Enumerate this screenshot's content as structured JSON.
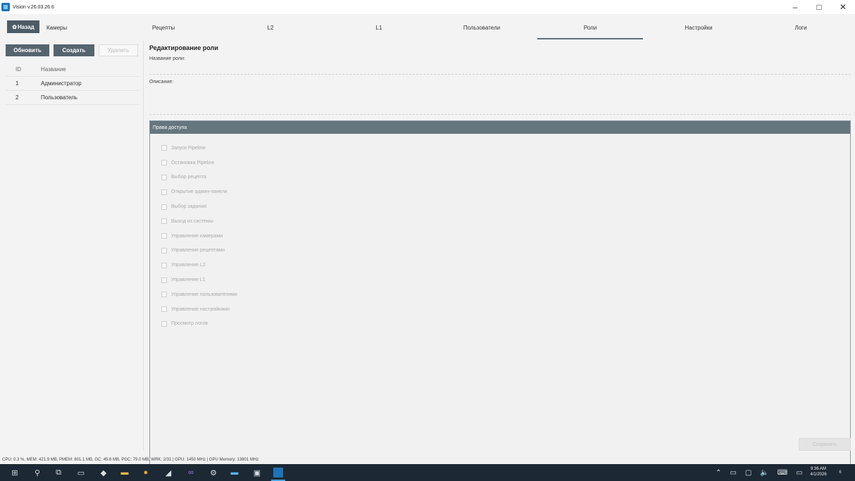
{
  "window": {
    "title": "Vision v.26.03.26.6",
    "controls": {
      "minimize": "–",
      "maximize": "□",
      "close": "✕"
    }
  },
  "nav": {
    "back_label": "Назад",
    "back_icon": "gear-icon",
    "tabs": [
      {
        "label": "Камеры",
        "active": false
      },
      {
        "label": "Рецепты",
        "active": false
      },
      {
        "label": "L2",
        "active": false
      },
      {
        "label": "L1",
        "active": false
      },
      {
        "label": "Пользователи",
        "active": false
      },
      {
        "label": "Роли",
        "active": true
      },
      {
        "label": "Настройки",
        "active": false
      },
      {
        "label": "Логи",
        "active": false
      }
    ]
  },
  "sidebar": {
    "buttons": {
      "refresh": "Обновить",
      "create": "Создать",
      "delete": "Удалить"
    },
    "table": {
      "headers": {
        "id": "ID",
        "name": "Название"
      },
      "rows": [
        {
          "id": "1",
          "name": "Администратор"
        },
        {
          "id": "2",
          "name": "Пользователь"
        }
      ]
    }
  },
  "editor": {
    "title": "Редактирование роли",
    "name_label": "Название роли:",
    "name_value": "",
    "description_label": "Описание:",
    "description_value": "",
    "permissions_header": "Права доступа",
    "permissions": [
      "Запуск Pipeline",
      "Остановка Pipeline",
      "Выбор рецепта",
      "Открытие админ-панели",
      "Выбор задания",
      "Выход из системы",
      "Управление камерами",
      "Управление рецептами",
      "Управление L2",
      "Управление L1",
      "Управление пользователями",
      "Управление настройками",
      "Просмотр логов"
    ],
    "save_label": "Сохранить"
  },
  "status_bar": "CPU: 0.3 %, MEM: 421.9 MB, PMEM: 801.1 MB, GC: 45.8 MB, PGC: 79.0 MB, WRK: 2/31 | GPU: 1450 MHz | GPU Memory: 13801 MHz",
  "taskbar": {
    "clock_time": "9:36 AM",
    "clock_date": "4/1/2026",
    "notification_count": "6",
    "colors": {
      "background": "#1c2833",
      "active_indicator": "#4aa3e0"
    }
  },
  "colors": {
    "accent_dark": "#4d5b66",
    "panel_header": "#66767f",
    "background": "#f3f3f3"
  }
}
